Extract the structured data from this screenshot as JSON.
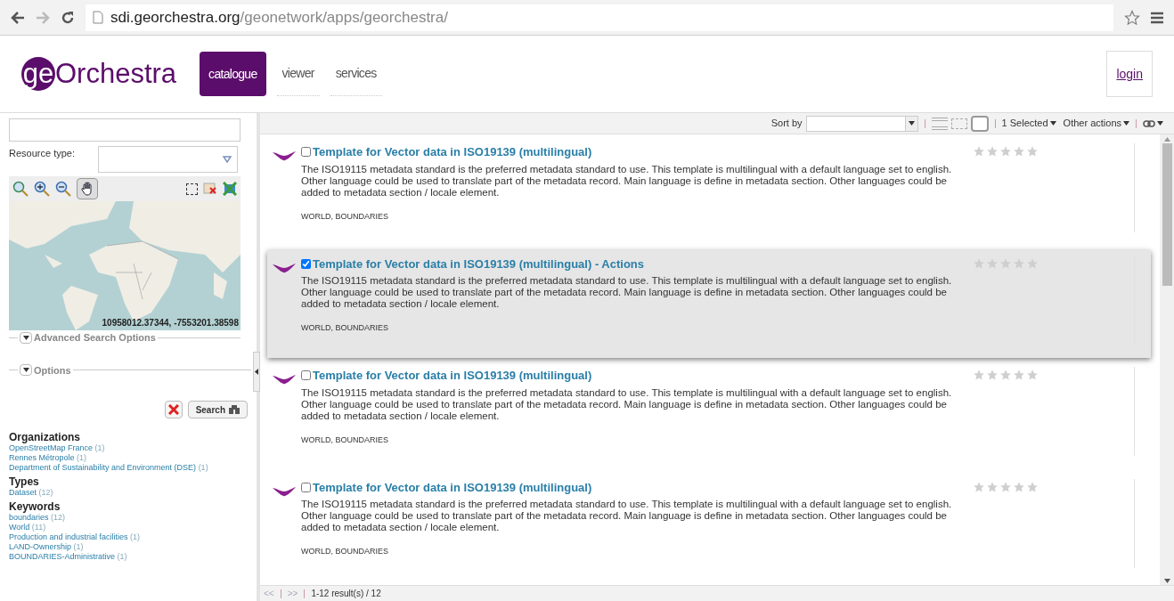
{
  "browser": {
    "url_host": "sdi.georchestra.org",
    "url_path": "/geonetwork/apps/georchestra/"
  },
  "header": {
    "logo_prefix": "ge",
    "logo_rest": "Orchestra",
    "tabs": [
      {
        "label": "catalogue",
        "selected": true
      },
      {
        "label": "viewer",
        "selected": false
      },
      {
        "label": "services",
        "selected": false
      }
    ],
    "login": "login"
  },
  "search": {
    "resource_type_label": "Resource type:",
    "map_coordinates": "10958012.37344, -7553201.38598",
    "map_tool_pan_active": true,
    "sections": [
      {
        "label": "Advanced Search Options",
        "expanded": false
      },
      {
        "label": "Options",
        "expanded": false
      }
    ],
    "search_button": "Search"
  },
  "facets": [
    {
      "title": "Organizations",
      "items": [
        {
          "label": "OpenStreetMap France",
          "count": "(1)"
        },
        {
          "label": "Rennes Métropole",
          "count": "(1)"
        },
        {
          "label": "Department of Sustainability and Environment (DSE)",
          "count": "(1)"
        }
      ]
    },
    {
      "title": "Types",
      "items": [
        {
          "label": "Dataset",
          "count": "(12)"
        }
      ]
    },
    {
      "title": "Keywords",
      "items": [
        {
          "label": "boundaries",
          "count": "(12)"
        },
        {
          "label": "World",
          "count": "(11)"
        },
        {
          "label": "Production and industrial facilities",
          "count": "(1)"
        },
        {
          "label": "LAND-Ownership",
          "count": "(1)"
        },
        {
          "label": "BOUNDARIES-Administrative",
          "count": "(1)"
        }
      ]
    }
  ],
  "toolbar": {
    "sort_label": "Sort by",
    "selected_menu": "1 Selected",
    "other_actions": "Other actions"
  },
  "records": [
    {
      "title": "Template for Vector data in ISO19139 (multilingual)",
      "checked": false,
      "selected": false,
      "stars": 0,
      "abstract": "The ISO19115 metadata standard is the preferred metadata standard to use. This template is multilingual with a default language set to english. Other language could be used to translate part of the metadata record. Main language is define in metadata section. Other languages could be added to metadata section / locale element.",
      "keywords": "WORLD, BOUNDARIES"
    },
    {
      "title": "Template for Vector data in ISO19139 (multilingual) - Actions",
      "checked": true,
      "selected": true,
      "stars": 0,
      "abstract": "The ISO19115 metadata standard is the preferred metadata standard to use. This template is multilingual with a default language set to english. Other language could be used to translate part of the metadata record. Main language is define in metadata section. Other languages could be added to metadata section / locale element.",
      "keywords": "WORLD, BOUNDARIES"
    },
    {
      "title": "Template for Vector data in ISO19139 (multilingual)",
      "checked": false,
      "selected": false,
      "stars": 0,
      "abstract": "The ISO19115 metadata standard is the preferred metadata standard to use. This template is multilingual with a default language set to english. Other language could be used to translate part of the metadata record. Main language is define in metadata section. Other languages could be added to metadata section / locale element.",
      "keywords": "WORLD, BOUNDARIES"
    },
    {
      "title": "Template for Vector data in ISO19139 (multilingual)",
      "checked": false,
      "selected": false,
      "stars": 0,
      "abstract": "The ISO19115 metadata standard is the preferred metadata standard to use. This template is multilingual with a default language set to english. Other language could be used to translate part of the metadata record. Main language is define in metadata section. Other languages could be added to metadata section / locale element.",
      "keywords": "WORLD, BOUNDARIES"
    }
  ],
  "pager": {
    "prev": "<<",
    "next": ">>",
    "summary": "1-12 result(s) / 12"
  }
}
